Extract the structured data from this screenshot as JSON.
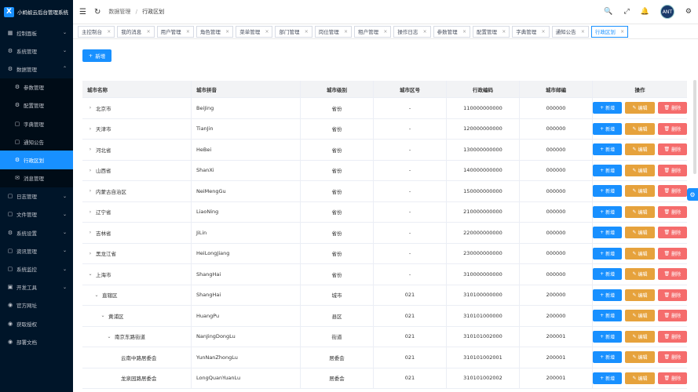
{
  "app": {
    "logo_mark": "X",
    "title": "小蚂蚁云后台管理系统"
  },
  "sidebar": {
    "items": [
      {
        "label": "控制面板",
        "icon": "▦",
        "arrow": "⌄",
        "level": 0
      },
      {
        "label": "系统管理",
        "icon": "⚙",
        "arrow": "⌄",
        "level": 0
      },
      {
        "label": "数据管理",
        "icon": "⚙",
        "arrow": "⌃",
        "level": 0
      },
      {
        "label": "参数管理",
        "icon": "⚙",
        "arrow": "",
        "level": 1
      },
      {
        "label": "配置管理",
        "icon": "⚙",
        "arrow": "",
        "level": 1
      },
      {
        "label": "字典管理",
        "icon": "▢",
        "arrow": "",
        "level": 1
      },
      {
        "label": "通知公告",
        "icon": "▢",
        "arrow": "",
        "level": 1
      },
      {
        "label": "行政区划",
        "icon": "⚙",
        "arrow": "",
        "level": 1,
        "active": true
      },
      {
        "label": "消息管理",
        "icon": "✉",
        "arrow": "",
        "level": 1
      },
      {
        "label": "日志管理",
        "icon": "▢",
        "arrow": "⌄",
        "level": 0
      },
      {
        "label": "文件管理",
        "icon": "▢",
        "arrow": "⌄",
        "level": 0
      },
      {
        "label": "系统设置",
        "icon": "⚙",
        "arrow": "⌄",
        "level": 0
      },
      {
        "label": "资讯管理",
        "icon": "▢",
        "arrow": "⌄",
        "level": 0
      },
      {
        "label": "系统监控",
        "icon": "▢",
        "arrow": "⌄",
        "level": 0
      },
      {
        "label": "开发工具",
        "icon": "▣",
        "arrow": "⌄",
        "level": 0
      },
      {
        "label": "官方网址",
        "icon": "◉",
        "arrow": "",
        "level": 0
      },
      {
        "label": "获取授权",
        "icon": "◉",
        "arrow": "",
        "level": 0
      },
      {
        "label": "部署文档",
        "icon": "◉",
        "arrow": "",
        "level": 0
      }
    ]
  },
  "topbar": {
    "menu_icon": "☰",
    "refresh_icon": "↻",
    "breadcrumb": [
      "数据管理",
      "行政区划"
    ],
    "right_icons": [
      "🔍",
      "⤢",
      "🔔",
      "⚙"
    ],
    "avatar_text": "ANT"
  },
  "tags": [
    {
      "label": "主控制台",
      "active": false
    },
    {
      "label": "我的消息",
      "active": false
    },
    {
      "label": "用户管理",
      "active": false
    },
    {
      "label": "角色管理",
      "active": false
    },
    {
      "label": "菜单管理",
      "active": false
    },
    {
      "label": "部门管理",
      "active": false
    },
    {
      "label": "岗位管理",
      "active": false
    },
    {
      "label": "租户管理",
      "active": false
    },
    {
      "label": "操作日志",
      "active": false
    },
    {
      "label": "参数管理",
      "active": false
    },
    {
      "label": "配置管理",
      "active": false
    },
    {
      "label": "字典管理",
      "active": false
    },
    {
      "label": "通知公告",
      "active": false
    },
    {
      "label": "行政区划",
      "active": true
    }
  ],
  "toolbar": {
    "add_label": "新增",
    "add_icon": "+"
  },
  "table": {
    "headers": [
      "城市名称",
      "城市拼音",
      "城市级别",
      "城市区号",
      "行政编码",
      "城市邮编",
      "操作"
    ],
    "actions": {
      "add": "新增",
      "edit": "编辑",
      "delete": "删除",
      "add_icon": "+",
      "edit_icon": "✎",
      "delete_icon": "🗑"
    },
    "rows": [
      {
        "name": "北京市",
        "pinyin": "BeiJing",
        "level": "省份",
        "area_code": "-",
        "admin_code": "110000000000",
        "zip": "000000",
        "depth": 0,
        "expander": "›"
      },
      {
        "name": "天津市",
        "pinyin": "TianJin",
        "level": "省份",
        "area_code": "-",
        "admin_code": "120000000000",
        "zip": "000000",
        "depth": 0,
        "expander": "›"
      },
      {
        "name": "河北省",
        "pinyin": "HeBei",
        "level": "省份",
        "area_code": "-",
        "admin_code": "130000000000",
        "zip": "000000",
        "depth": 0,
        "expander": "›"
      },
      {
        "name": "山西省",
        "pinyin": "ShanXi",
        "level": "省份",
        "area_code": "-",
        "admin_code": "140000000000",
        "zip": "000000",
        "depth": 0,
        "expander": "›"
      },
      {
        "name": "内蒙古自治区",
        "pinyin": "NeiMengGu",
        "level": "省份",
        "area_code": "-",
        "admin_code": "150000000000",
        "zip": "000000",
        "depth": 0,
        "expander": "›"
      },
      {
        "name": "辽宁省",
        "pinyin": "LiaoNing",
        "level": "省份",
        "area_code": "-",
        "admin_code": "210000000000",
        "zip": "000000",
        "depth": 0,
        "expander": "›"
      },
      {
        "name": "吉林省",
        "pinyin": "JiLin",
        "level": "省份",
        "area_code": "-",
        "admin_code": "220000000000",
        "zip": "000000",
        "depth": 0,
        "expander": "›"
      },
      {
        "name": "黑龙江省",
        "pinyin": "HeiLongJiang",
        "level": "省份",
        "area_code": "-",
        "admin_code": "230000000000",
        "zip": "000000",
        "depth": 0,
        "expander": "›"
      },
      {
        "name": "上海市",
        "pinyin": "ShangHai",
        "level": "省份",
        "area_code": "-",
        "admin_code": "310000000000",
        "zip": "000000",
        "depth": 0,
        "expander": "⌄"
      },
      {
        "name": "直辖区",
        "pinyin": "ShangHai",
        "level": "城市",
        "area_code": "021",
        "admin_code": "310100000000",
        "zip": "200000",
        "depth": 1,
        "expander": "⌄"
      },
      {
        "name": "黄浦区",
        "pinyin": "HuangPu",
        "level": "县区",
        "area_code": "021",
        "admin_code": "310101000000",
        "zip": "200000",
        "depth": 2,
        "expander": "⌄"
      },
      {
        "name": "南京东路街道",
        "pinyin": "NanJingDongLu",
        "level": "街道",
        "area_code": "021",
        "admin_code": "310101002000",
        "zip": "200001",
        "depth": 3,
        "expander": "⌄"
      },
      {
        "name": "云南中路居委会",
        "pinyin": "YunNanZhongLu",
        "level": "居委会",
        "area_code": "021",
        "admin_code": "310101002001",
        "zip": "200001",
        "depth": 4,
        "expander": ""
      },
      {
        "name": "龙泉园路居委会",
        "pinyin": "LongQuanYuanLu",
        "level": "居委会",
        "area_code": "021",
        "admin_code": "310101002002",
        "zip": "200001",
        "depth": 4,
        "expander": ""
      }
    ]
  },
  "settings_float_icon": "⚙"
}
